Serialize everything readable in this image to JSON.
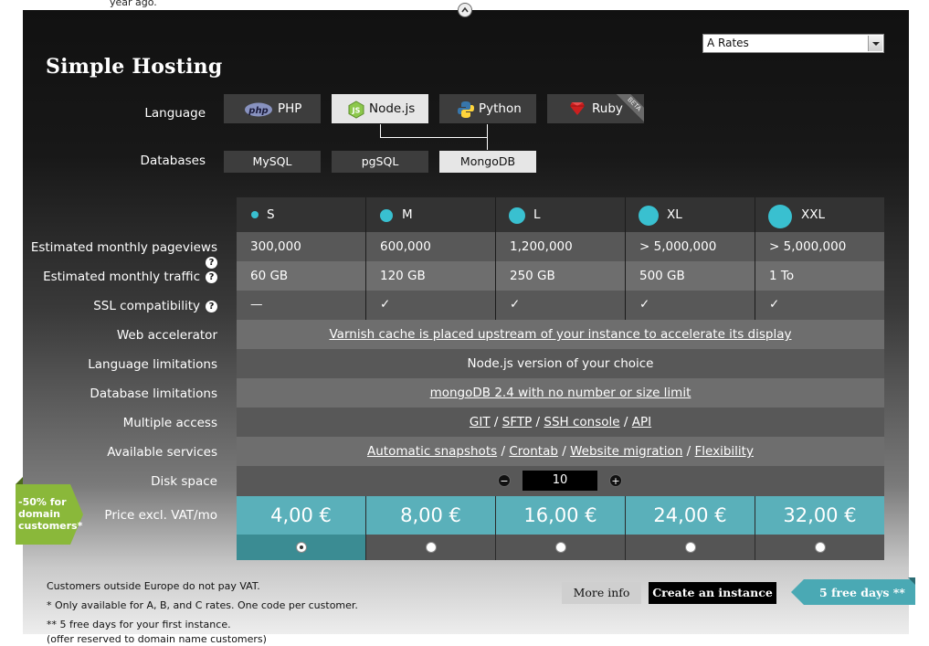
{
  "top_fragment": "year ago.",
  "title": "Simple Hosting",
  "rates_select": {
    "value": "A Rates"
  },
  "labels": {
    "language": "Language",
    "databases": "Databases"
  },
  "languages": [
    {
      "label": "PHP",
      "icon": "php-icon",
      "active": false
    },
    {
      "label": "Node.js",
      "icon": "nodejs-icon",
      "active": true
    },
    {
      "label": "Python",
      "icon": "python-icon",
      "active": false
    },
    {
      "label": "Ruby",
      "icon": "ruby-icon",
      "active": false,
      "badge": "BETA"
    }
  ],
  "databases": [
    {
      "label": "MySQL",
      "active": false
    },
    {
      "label": "pgSQL",
      "active": false
    },
    {
      "label": "MongoDB",
      "active": true
    }
  ],
  "sizes": [
    "S",
    "M",
    "L",
    "XL",
    "XXL"
  ],
  "row_labels": {
    "pageviews": "Estimated monthly pageviews",
    "traffic": "Estimated monthly traffic",
    "ssl": "SSL compatibility",
    "web_accel": "Web accelerator",
    "lang_limits": "Language limitations",
    "db_limits": "Database limitations",
    "multi_access": "Multiple access",
    "services": "Available services",
    "disk": "Disk space",
    "price": "Price excl. VAT/mo"
  },
  "pageviews": [
    "300,000",
    "600,000",
    "1,200,000",
    "> 5,000,000",
    "> 5,000,000"
  ],
  "traffic": [
    "60 GB",
    "120 GB",
    "250 GB",
    "500 GB",
    "1 To"
  ],
  "ssl": [
    "—",
    "✓",
    "✓",
    "✓",
    "✓"
  ],
  "web_accel": "Varnish cache is placed upstream of your instance to accelerate its display",
  "lang_limits": "Node.js version of your choice",
  "db_limits": "mongoDB 2.4 with no number or size limit",
  "multi_access": {
    "links": [
      "GIT",
      "SFTP",
      "SSH console",
      "API"
    ],
    "sep": "/"
  },
  "services": {
    "links": [
      "Automatic snapshots",
      "Crontab",
      "Website migration",
      "Flexibility"
    ],
    "sep": "/"
  },
  "disk": {
    "value": "10",
    "minus": "−",
    "plus": "+"
  },
  "prices": [
    "4,00 €",
    "8,00 €",
    "16,00 €",
    "24,00 €",
    "32,00 €"
  ],
  "selected_plan": 0,
  "promo": {
    "line1": "-50% for",
    "line2": "domain",
    "line3": "customers*"
  },
  "notes": [
    "Customers outside Europe do not pay VAT.",
    "* Only available for A, B, and C rates. One code per customer.",
    "** 5 free days for your first instance.",
    "(offer reserved to domain name customers)"
  ],
  "buttons": {
    "more_info": "More info",
    "create": "Create an instance"
  },
  "ribbon": "5 free days **",
  "colors": {
    "accent": "#5ab0ba",
    "promo": "#8ab83a",
    "ribbon": "#4aa9b4"
  }
}
